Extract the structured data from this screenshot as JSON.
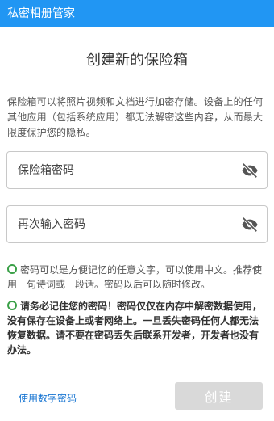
{
  "app": {
    "title": "私密相册管家"
  },
  "page": {
    "title": "创建新的保险箱"
  },
  "intro": "保险箱可以将照片视频和文档进行加密存储。设备上的任何其他应用（包括系统应用）都无法解密这些内容，从而最大限度保护您的隐私。",
  "fields": {
    "password": {
      "placeholder": "保险箱密码",
      "icon": "eye-off-icon"
    },
    "confirm": {
      "placeholder": "再次输入密码",
      "icon": "eye-off-icon"
    }
  },
  "notes": {
    "tip": "密码可以是方便记忆的任意文字，可以使用中文。推荐使用一句诗词或一段话。密码以后可以随时修改。",
    "warning": "请务必记住您的密码！密码仅仅在内存中解密数据使用，没有保存在设备上或者网络上。一旦丢失密码任何人都无法恢复数据。请不要在密码丢失后联系开发者，开发者也没有办法。"
  },
  "actions": {
    "use_numeric": "使用数字密码",
    "create": "创建"
  },
  "colors": {
    "app_bar": "#2196F3",
    "accent_green": "#3aa047",
    "link": "#1976D2",
    "button_disabled": "#d9d9d9"
  }
}
